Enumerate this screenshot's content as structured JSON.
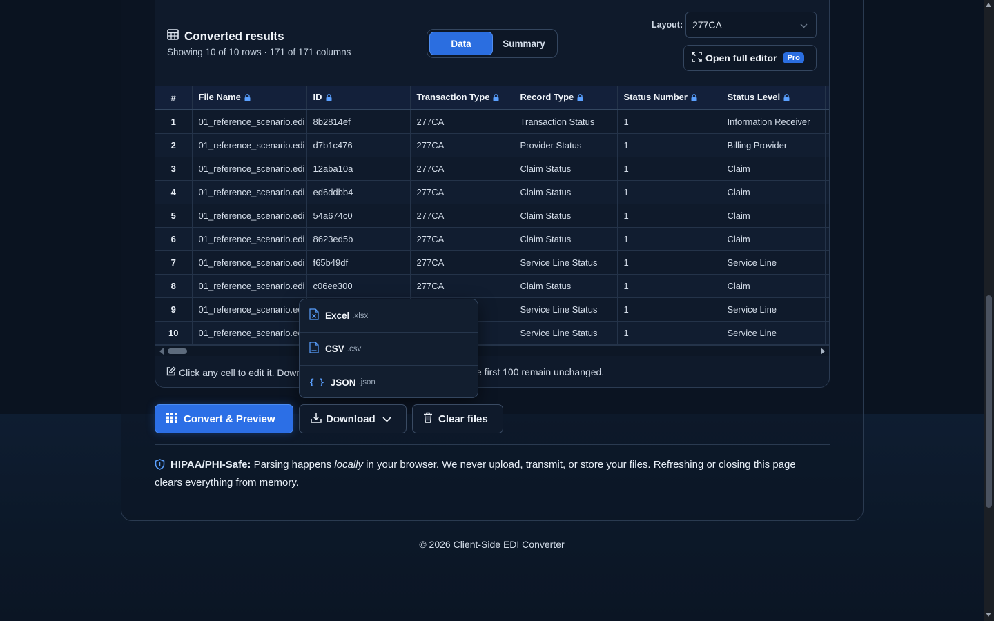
{
  "results": {
    "title": "Converted results",
    "subtitle": "Showing 10 of 10 rows · 171 of 171 columns",
    "icon": "table-icon"
  },
  "view_toggle": {
    "data_label": "Data",
    "summary_label": "Summary",
    "active": "Data"
  },
  "layout": {
    "label": "Layout:",
    "value": "277CA"
  },
  "open_editor": {
    "label": "Open full editor",
    "badge": "Pro"
  },
  "table": {
    "columns": [
      "#",
      "File Name",
      "ID",
      "Transaction Type",
      "Record Type",
      "Status Number",
      "Status Level"
    ],
    "rows": [
      [
        "1",
        "01_reference_scenario.edi",
        "8b2814ef",
        "277CA",
        "Transaction Status",
        "1",
        "Information Receiver"
      ],
      [
        "2",
        "01_reference_scenario.edi",
        "d7b1c476",
        "277CA",
        "Provider Status",
        "1",
        "Billing Provider"
      ],
      [
        "3",
        "01_reference_scenario.edi",
        "12aba10a",
        "277CA",
        "Claim Status",
        "1",
        "Claim"
      ],
      [
        "4",
        "01_reference_scenario.edi",
        "ed6ddbb4",
        "277CA",
        "Claim Status",
        "1",
        "Claim"
      ],
      [
        "5",
        "01_reference_scenario.edi",
        "54a674c0",
        "277CA",
        "Claim Status",
        "1",
        "Claim"
      ],
      [
        "6",
        "01_reference_scenario.edi",
        "8623ed5b",
        "277CA",
        "Claim Status",
        "1",
        "Claim"
      ],
      [
        "7",
        "01_reference_scenario.edi",
        "f65b49df",
        "277CA",
        "Service Line Status",
        "1",
        "Service Line"
      ],
      [
        "8",
        "01_reference_scenario.edi",
        "c06ee300",
        "277CA",
        "Claim Status",
        "1",
        "Claim"
      ],
      [
        "9",
        "01_reference_scenario.edi",
        "",
        "",
        "Service Line Status",
        "1",
        "Service Line"
      ],
      [
        "10",
        "01_reference_scenario.edi",
        "",
        "",
        "Service Line Status",
        "1",
        "Service Line"
      ]
    ]
  },
  "hint": {
    "left": "Click any cell to edit it. Down",
    "right": "e first 100 remain unchanged."
  },
  "download_menu": [
    {
      "name": "Excel",
      "ext": ".xlsx",
      "icon": "excel-file-icon"
    },
    {
      "name": "CSV",
      "ext": ".csv",
      "icon": "csv-file-icon"
    },
    {
      "name": "JSON",
      "ext": ".json",
      "icon": "json-braces-icon"
    }
  ],
  "actions": {
    "convert": "Convert & Preview",
    "download": "Download",
    "clear": "Clear files"
  },
  "notice": {
    "title": "HIPAA/PHI-Safe:",
    "text_before": " Parsing happens ",
    "emphasis": "locally",
    "text_after": " in your browser. We never upload, transmit, or store your files. Refreshing or closing this page clears everything from memory."
  },
  "footer": "© 2026 Client-Side EDI Converter",
  "colors": {
    "accent": "#2c6fe6",
    "background": "#0a1320",
    "card": "#0f1a2b"
  }
}
